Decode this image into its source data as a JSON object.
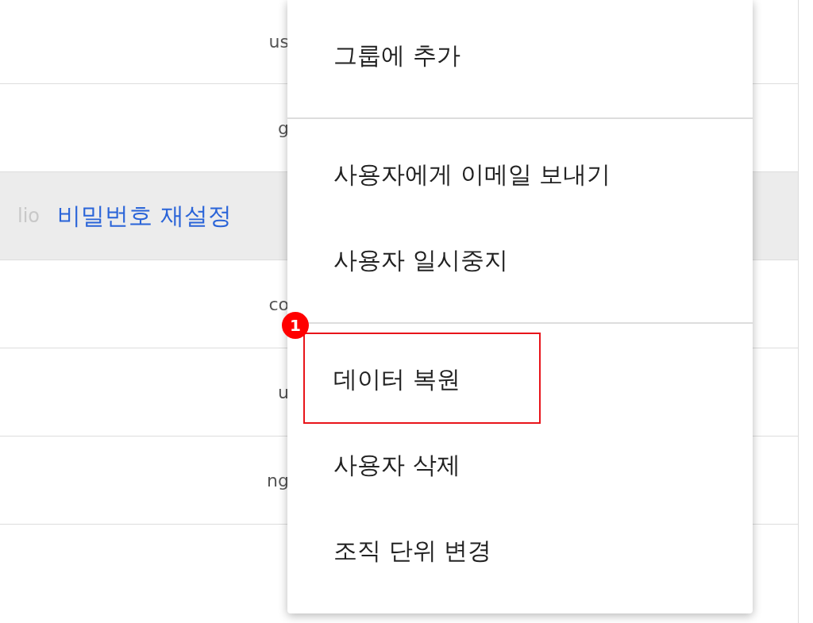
{
  "table": {
    "rows": [
      {
        "fragment": "us",
        "selected": false
      },
      {
        "fragment": "g",
        "selected": false
      },
      {
        "fragment": "lio",
        "link": "비밀번호 재설정",
        "selected": true
      },
      {
        "fragment": "co",
        "selected": false
      },
      {
        "fragment": "u",
        "selected": false
      },
      {
        "fragment": "ng",
        "selected": false
      }
    ]
  },
  "menu": {
    "sections": [
      {
        "items": [
          {
            "label": "그룹에 추가",
            "highlighted": false
          }
        ]
      },
      {
        "items": [
          {
            "label": "사용자에게 이메일 보내기",
            "highlighted": false
          },
          {
            "label": "사용자 일시중지",
            "highlighted": false
          }
        ]
      },
      {
        "items": [
          {
            "label": "데이터 복원",
            "highlighted": true,
            "badge": "1"
          },
          {
            "label": "사용자 삭제",
            "highlighted": false
          },
          {
            "label": "조직 단위 변경",
            "highlighted": false
          }
        ]
      }
    ]
  }
}
